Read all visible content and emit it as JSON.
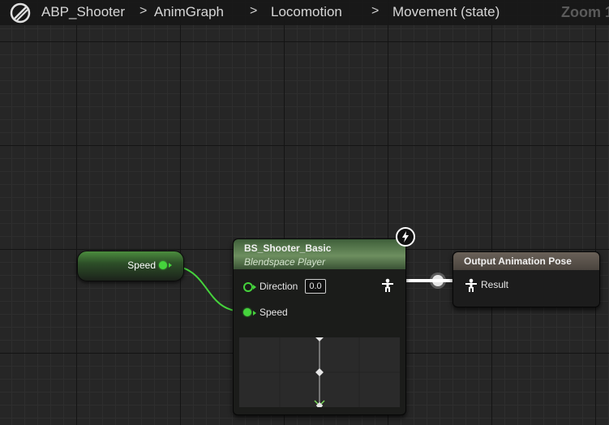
{
  "breadcrumb": {
    "asset": "ABP_Shooter",
    "graph": "AnimGraph",
    "state_machine": "Locomotion",
    "state": "Movement (state)",
    "separator": ">"
  },
  "zoom_label": "Zoom 1",
  "speed_variable_node": {
    "label": "Speed"
  },
  "blendspace_node": {
    "title": "BS_Shooter_Basic",
    "subtitle": "Blendspace Player",
    "pins": {
      "direction_label": "Direction",
      "direction_value": "0.0",
      "speed_label": "Speed"
    },
    "preview_icons": [
      "diamond-sample-icon",
      "diamond-sample-icon",
      "current-sample-cross-icon"
    ]
  },
  "output_node": {
    "title": "Output Animation Pose",
    "result_label": "Result"
  },
  "colors": {
    "float_pin": "#45d33c",
    "pose_wire": "#ffffff",
    "blendspace_header": "#6d8f5f",
    "output_header": "#6a6158",
    "graph_background": "#262626"
  },
  "icons": {
    "graph_type": "anim-graph-icon",
    "fast_path": "lightning-icon",
    "pose_pin": "pose-person-icon"
  }
}
